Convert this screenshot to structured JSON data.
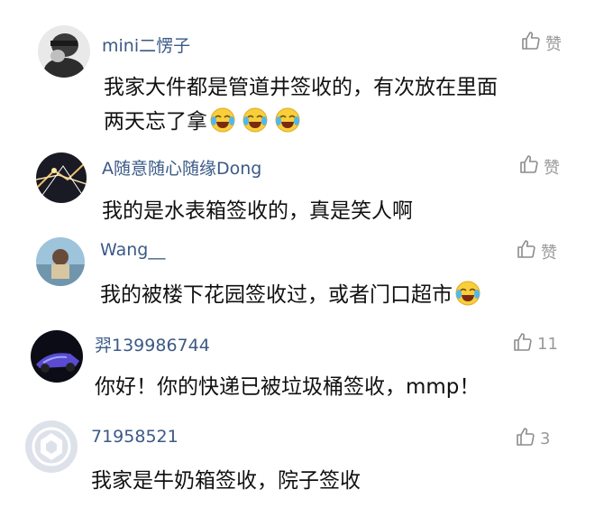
{
  "comments": [
    {
      "username": "mini二愣子",
      "likes": "赞",
      "lines": [
        "我家大件都是管道井签收的，有次放在里面",
        "两天忘了拿"
      ],
      "emoji_icon": "crying-laughing-emoji",
      "emoji_count": 3
    },
    {
      "username": "A随意随心随缘Dong",
      "likes": "赞",
      "lines": [
        "我的是水表箱签收的，真是笑人啊"
      ]
    },
    {
      "username": "Wang__",
      "likes": "赞",
      "lines": [
        "我的被楼下花园签收过，或者门口超市"
      ],
      "emoji_icon": "crying-laughing-emoji",
      "emoji_count": 1
    },
    {
      "username": "羿139986744",
      "likes": "11",
      "lines": [
        "你好！你的快递已被垃圾桶签收，mmp！"
      ]
    },
    {
      "username": "71958521",
      "likes": "3",
      "lines": [
        "我家是牛奶箱签收，院子签收"
      ]
    }
  ],
  "colors": {
    "username": "#3b5a86",
    "text": "#111111",
    "likes": "#9a9a9a"
  }
}
